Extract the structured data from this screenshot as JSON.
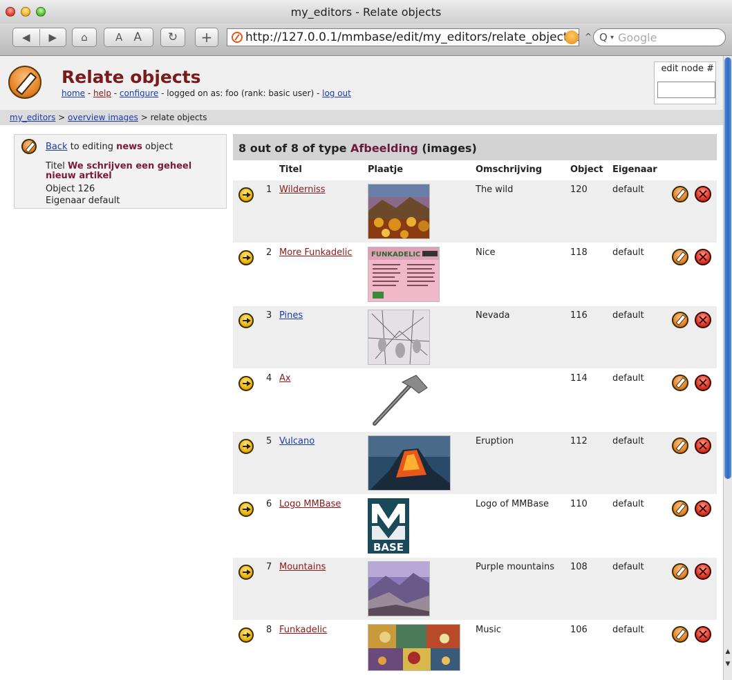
{
  "window": {
    "title": "my_editors - Relate objects"
  },
  "toolbar": {
    "back_icon": "◀",
    "forward_icon": "▶",
    "home_icon": "⌂",
    "text_smaller": "A",
    "text_bigger": "A",
    "reload_icon": "↻",
    "add_icon": "+",
    "url": "http://127.0.0.1/mmbase/edit/my_editors/relate_object.jsp",
    "search_placeholder": "Google"
  },
  "header": {
    "title": "Relate objects",
    "menu": {
      "home": "home",
      "sep1": " - ",
      "help": "help",
      "sep2": " - ",
      "configure": "configure",
      "logged_on": " - logged on as: foo (rank: basic user) - ",
      "logout": "log out"
    },
    "edit_node_label": "edit node #"
  },
  "breadcrumb": {
    "root": "my_editors",
    "sep1": " > ",
    "overview": "overview images",
    "sep2": " > ",
    "current": "relate objects"
  },
  "source_object": {
    "back_link": "Back",
    "back_text": " to editing ",
    "type": "news",
    "object_word": " object",
    "title_label": "Titel ",
    "title_value": "We schrijven een geheel nieuw artikel",
    "object_line": "Object 126",
    "owner_line": "Eigenaar default"
  },
  "list": {
    "count_text": "8 out of 8 of type ",
    "type_name": "Afbeelding",
    "type_suffix": " (images)",
    "columns": {
      "titel": "Titel",
      "plaatje": "Plaatje",
      "omschrijving": "Omschrijving",
      "object": "Object",
      "eigenaar": "Eigenaar"
    },
    "rows": [
      {
        "num": "1",
        "title": "Wilderniss",
        "desc": "The wild",
        "object": "120",
        "owner": "default",
        "visited": true
      },
      {
        "num": "2",
        "title": "More Funkadelic",
        "desc": "Nice",
        "object": "118",
        "owner": "default",
        "visited": true,
        "thumb_text": "FUNKADELIC"
      },
      {
        "num": "3",
        "title": "Pines",
        "desc": "Nevada",
        "object": "116",
        "owner": "default",
        "visited": false
      },
      {
        "num": "4",
        "title": "Ax",
        "desc": "",
        "object": "114",
        "owner": "default",
        "visited": true
      },
      {
        "num": "5",
        "title": "Vulcano",
        "desc": "Eruption",
        "object": "112",
        "owner": "default",
        "visited": false
      },
      {
        "num": "6",
        "title": "Logo MMBase",
        "desc": "Logo of MMBase",
        "object": "110",
        "owner": "default",
        "visited": true,
        "thumb_text": "BASE"
      },
      {
        "num": "7",
        "title": "Mountains",
        "desc": "Purple mountains",
        "object": "108",
        "owner": "default",
        "visited": true
      },
      {
        "num": "8",
        "title": "Funkadelic",
        "desc": "Music",
        "object": "106",
        "owner": "default",
        "visited": true
      }
    ]
  },
  "colors": {
    "title": "#7a1a1a",
    "link": "#1a3ab0",
    "visited_link": "#8a1a1a",
    "row_shade": "#eeeeee"
  }
}
